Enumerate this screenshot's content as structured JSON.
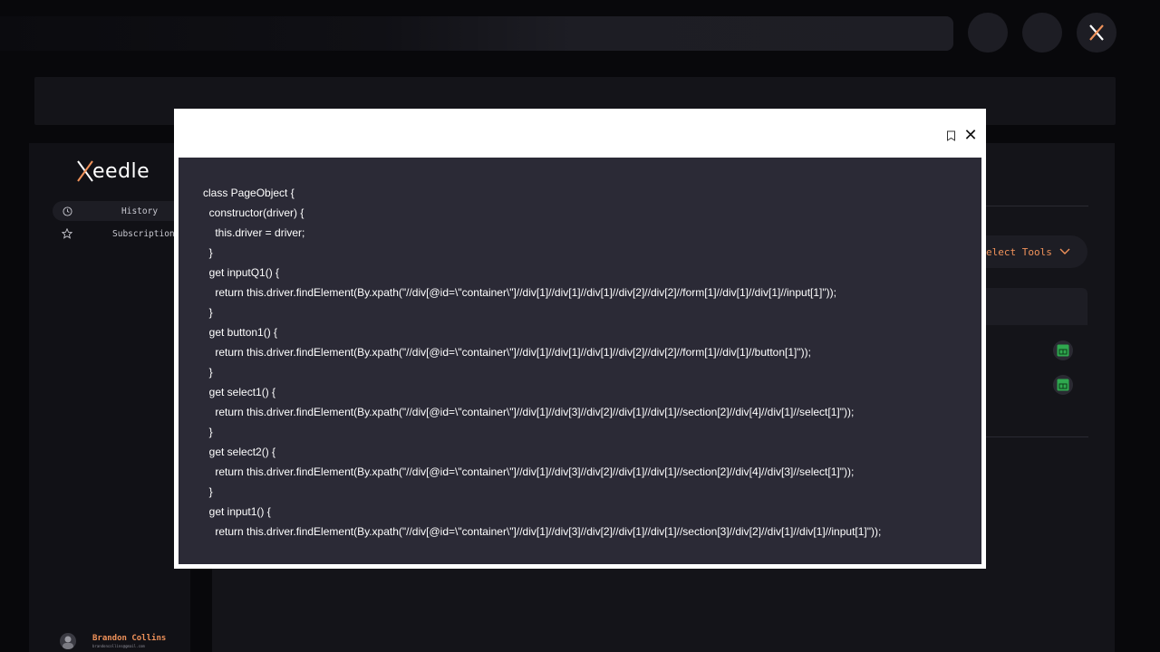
{
  "brand": {
    "logo_text": "Xeedle"
  },
  "sidebar": {
    "items": [
      {
        "label": "History",
        "icon": "clock-icon"
      },
      {
        "label": "Subscription",
        "icon": "star-icon"
      }
    ],
    "user": {
      "name": "Brandon Collins",
      "email": "brandoncollins@gmail.com"
    }
  },
  "main": {
    "select_tools_label": "elect Tools"
  },
  "modal": {
    "code_lines": [
      "class PageObject {",
      "  constructor(driver) {",
      "    this.driver = driver;",
      "  }",
      "  get inputQ1() {",
      "    return this.driver.findElement(By.xpath(\"//div[@id=\\\"container\\\"]//div[1]//div[1]//div[1]//div[2]//div[2]//form[1]//div[1]//div[1]//input[1]\"));",
      "  }",
      "  get button1() {",
      "    return this.driver.findElement(By.xpath(\"//div[@id=\\\"container\\\"]//div[1]//div[1]//div[1]//div[2]//div[2]//form[1]//div[1]//button[1]\"));",
      "  }",
      "  get select1() {",
      "    return this.driver.findElement(By.xpath(\"//div[@id=\\\"container\\\"]//div[1]//div[3]//div[2]//div[1]//div[1]//section[2]//div[4]//div[1]//select[1]\"));",
      "  }",
      "  get select2() {",
      "    return this.driver.findElement(By.xpath(\"//div[@id=\\\"container\\\"]//div[1]//div[3]//div[2]//div[1]//div[1]//section[2]//div[4]//div[3]//select[1]\"));",
      "  }",
      "  get input1() {",
      "    return this.driver.findElement(By.xpath(\"//div[@id=\\\"container\\\"]//div[1]//div[3]//div[2]//div[1]//div[1]//section[3]//div[2]//div[1]//div[1]//input[1]\"));"
    ],
    "close_glyph": "✕"
  },
  "colors": {
    "accent": "#f0925a",
    "code_bg": "#2b2a36",
    "panel": "#141419"
  }
}
